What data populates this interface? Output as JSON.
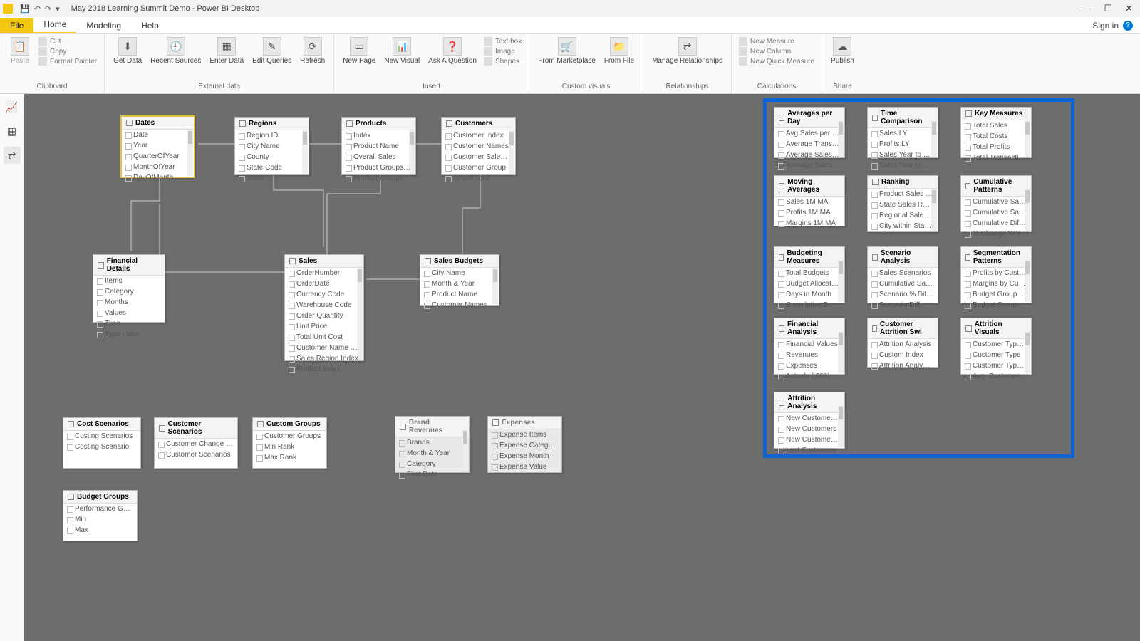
{
  "window": {
    "title": "May 2018 Learning Summit Demo - Power BI Desktop",
    "min": "—",
    "max": "☐",
    "close": "✕",
    "signin": "Sign in"
  },
  "qat": {
    "save": "💾",
    "undo": "↶",
    "redo": "↷",
    "more": "▾"
  },
  "tabs": {
    "file": "File",
    "home": "Home",
    "modeling": "Modeling",
    "help": "Help"
  },
  "ribbon": {
    "clipboard": {
      "label": "Clipboard",
      "paste": "Paste",
      "cut": "Cut",
      "copy": "Copy",
      "fp": "Format Painter"
    },
    "external": {
      "label": "External data",
      "get": "Get Data",
      "recent": "Recent Sources",
      "enter": "Enter Data",
      "edit": "Edit Queries",
      "refresh": "Refresh"
    },
    "insert": {
      "label": "Insert",
      "newpage": "New Page",
      "newvisual": "New Visual",
      "ask": "Ask A Question",
      "textbox": "Text box",
      "image": "Image",
      "shapes": "Shapes"
    },
    "custom": {
      "label": "Custom visuals",
      "market": "From Marketplace",
      "file": "From File"
    },
    "rel": {
      "label": "Relationships",
      "manage": "Manage Relationships"
    },
    "calc": {
      "label": "Calculations",
      "measure": "New Measure",
      "column": "New Column",
      "quick": "New Quick Measure"
    },
    "share": {
      "label": "Share",
      "publish": "Publish"
    }
  },
  "entities": {
    "dates": {
      "title": "Dates",
      "rows": [
        "Date",
        "Year",
        "QuarterOfYear",
        "MonthOfYear",
        "DayOfMonth"
      ]
    },
    "regions": {
      "title": "Regions",
      "rows": [
        "Region ID",
        "City Name",
        "County",
        "State Code",
        "State"
      ]
    },
    "products": {
      "title": "Products",
      "rows": [
        "Index",
        "Product Name",
        "Overall Sales",
        "Product Groups Ind",
        "Product Groups"
      ]
    },
    "customers": {
      "title": "Customers",
      "rows": [
        "Customer Index",
        "Customer Names",
        "Customer Sales Rank",
        "Customer Group",
        "Grand Total"
      ]
    },
    "findetails": {
      "title": "Financial Details",
      "rows": [
        "Items",
        "Category",
        "Months",
        "Values",
        "Type",
        "Type Index"
      ]
    },
    "sales": {
      "title": "Sales",
      "rows": [
        "OrderNumber",
        "OrderDate",
        "Currency Code",
        "Warehouse Code",
        "Order Quantity",
        "Unit Price",
        "Total Unit Cost",
        "Customer Name Index",
        "Sales Region Index",
        "Product Index"
      ]
    },
    "budgets": {
      "title": "Sales Budgets",
      "rows": [
        "City Name",
        "Month & Year",
        "Product Name",
        "Customer Names"
      ]
    },
    "costscen": {
      "title": "Cost Scenarios",
      "rows": [
        "Costing Scenarios",
        "Costing Scenario"
      ]
    },
    "custscen": {
      "title": "Customer Scenarios",
      "rows": [
        "Customer Change Scen",
        "Customer Scenarios"
      ]
    },
    "custgroups": {
      "title": "Custom Groups",
      "rows": [
        "Customer Groups",
        "Min Rank",
        "Max Rank"
      ]
    },
    "brandrev": {
      "title": "Brand Revenues",
      "rows": [
        "Brands",
        "Month & Year",
        "Category",
        "First Date"
      ]
    },
    "expenses": {
      "title": "Expenses",
      "rows": [
        "Expense Items",
        "Expense Category",
        "Expense Month",
        "Expense Value"
      ]
    },
    "budgroups": {
      "title": "Budget Groups",
      "rows": [
        "Performance Groups",
        "Min",
        "Max"
      ]
    },
    "avgday": {
      "title": "Averages per Day",
      "rows": [
        "Avg Sales per Day",
        "Average Transactions",
        "Average Sales per M",
        "Average Sales per Cu"
      ]
    },
    "timecomp": {
      "title": "Time Comparison",
      "rows": [
        "Sales LY",
        "Profits LY",
        "Sales Year to Date",
        "Sales Year to Date C"
      ]
    },
    "keymeas": {
      "title": "Key Measures",
      "rows": [
        "Total Sales",
        "Total Costs",
        "Total Profits",
        "Total Transactions"
      ]
    },
    "movavg": {
      "title": "Moving Averages",
      "rows": [
        "Sales 1M MA",
        "Profits 1M MA",
        "Margins 1M MA"
      ]
    },
    "ranking": {
      "title": "Ranking",
      "rows": [
        "Product Sales Rank",
        "State Sales Rank",
        "Regional Sales Rank",
        "City within State Sale"
      ]
    },
    "cumpat": {
      "title": "Cumulative Patterns",
      "rows": [
        "Cumulative Sales",
        "Cumulative Sales LY",
        "Cumulative Diff vs C",
        "% Change YoY"
      ]
    },
    "budmeas": {
      "title": "Budgeting Measures",
      "rows": [
        "Total Budgets",
        "Budget Allocation",
        "Days in Month",
        "Cumulative Budgets"
      ]
    },
    "scenan": {
      "title": "Scenario Analysis",
      "rows": [
        "Sales Scenarios",
        "Cumulative Sales Sc",
        "Scenario % Difference",
        "Scenario Diff"
      ]
    },
    "segpat": {
      "title": "Segmentation Patterns",
      "rows": [
        "Profits by Custom Gr",
        "Margins by Custom r",
        "Budget Group Sales",
        "Budget Group Count"
      ]
    },
    "finan": {
      "title": "Financial Analysis",
      "rows": [
        "Financial Values",
        "Revenues",
        "Expenses",
        "Actuals (,000)"
      ]
    },
    "custattr": {
      "title": "Customer Attrition Swi",
      "rows": [
        "Attrition Analysis",
        "Custom Index",
        "Attrition Analysis Type"
      ]
    },
    "attrvis": {
      "title": "Attrition Visuals",
      "rows": [
        "Customer Type Sales",
        "Customer Type",
        "Customer Type %",
        "Avg. Customer Type"
      ]
    },
    "attran": {
      "title": "Attrition Analysis",
      "rows": [
        "New Customer Sales",
        "New Customers",
        "New Customers %",
        "Lost Customers"
      ]
    }
  }
}
